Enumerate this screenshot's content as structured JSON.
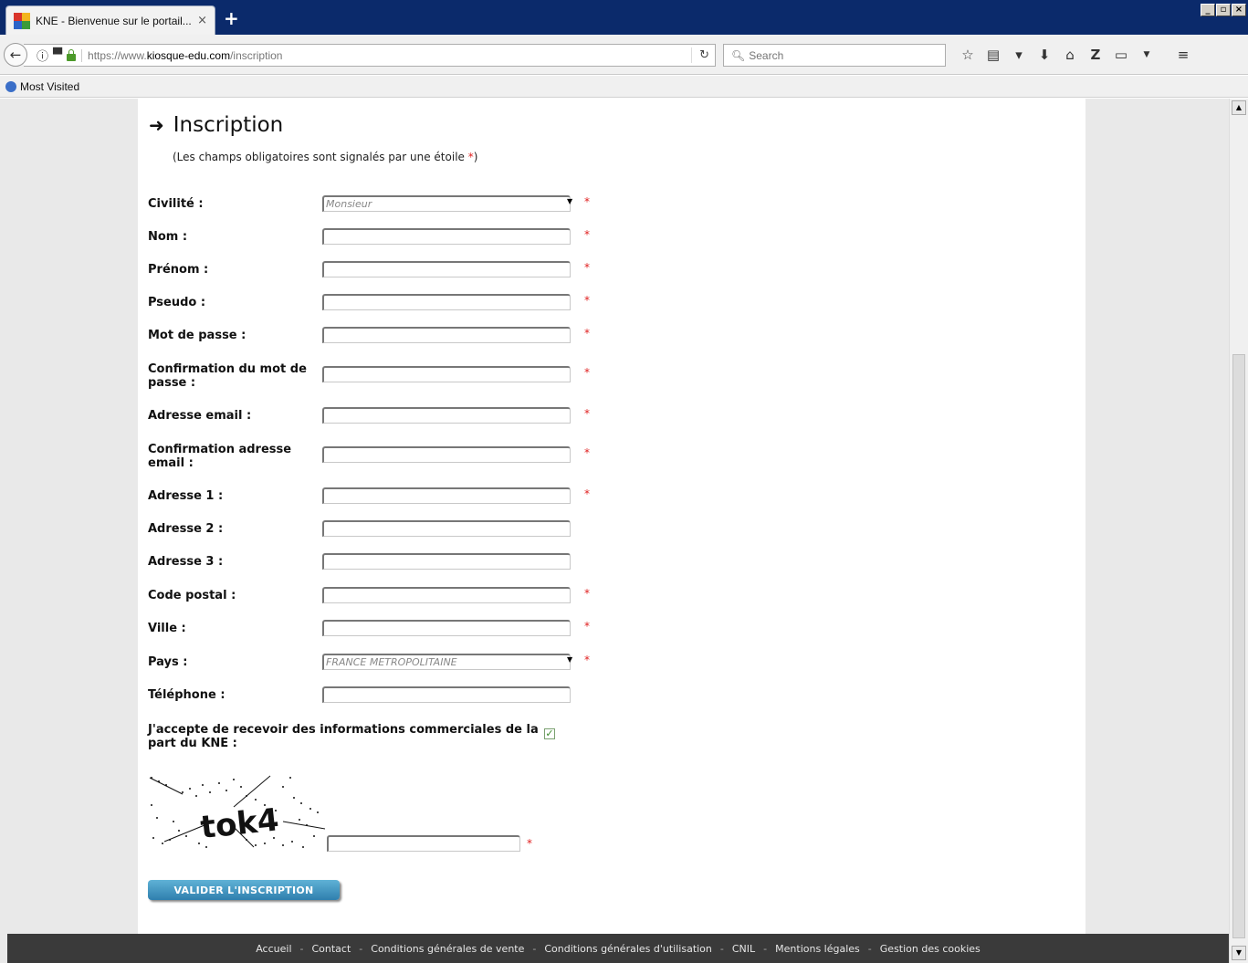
{
  "browser": {
    "tab_title": "KNE - Bienvenue sur le portail...",
    "tab_close": "×",
    "new_tab": "+",
    "url_prefix": "https://www.",
    "url_domain": "kiosque-edu.com",
    "url_path": "/inscription",
    "search_placeholder": "Search",
    "bookmark_label": "Most Visited",
    "window_buttons": [
      "_",
      "▫",
      "×"
    ],
    "toolbar_icons": [
      "star-icon",
      "reader-icon",
      "pocket-icon",
      "download-icon",
      "home-icon",
      "zotero-icon",
      "page-icon",
      "dropdown-icon",
      "menu-icon"
    ]
  },
  "page": {
    "title": "Inscription",
    "required_note_prefix": "(Les champs obligatoires sont signalés par une étoile ",
    "required_note_star": "*",
    "required_note_suffix": ")"
  },
  "form": {
    "required_marker": "*",
    "fields": [
      {
        "label": "Civilité :",
        "type": "select",
        "value": "Monsieur",
        "required": true
      },
      {
        "label": "Nom :",
        "type": "text",
        "value": "",
        "required": true
      },
      {
        "label": "Prénom :",
        "type": "text",
        "value": "",
        "required": true
      },
      {
        "label": "Pseudo :",
        "type": "text",
        "value": "",
        "required": true
      },
      {
        "label": "Mot de passe :",
        "type": "password",
        "value": "",
        "required": true
      },
      {
        "label": "Confirmation du mot de passe :",
        "type": "password",
        "value": "",
        "required": true
      },
      {
        "label": "Adresse email :",
        "type": "text",
        "value": "",
        "required": true
      },
      {
        "label": "Confirmation adresse email :",
        "type": "text",
        "value": "",
        "required": true
      },
      {
        "label": "Adresse 1 :",
        "type": "text",
        "value": "",
        "required": true
      },
      {
        "label": "Adresse 2 :",
        "type": "text",
        "value": "",
        "required": false
      },
      {
        "label": "Adresse 3 :",
        "type": "text",
        "value": "",
        "required": false
      },
      {
        "label": "Code postal :",
        "type": "text",
        "value": "",
        "required": true
      },
      {
        "label": "Ville :",
        "type": "text",
        "value": "",
        "required": true
      },
      {
        "label": "Pays :",
        "type": "select",
        "value": "FRANCE METROPOLITAINE",
        "required": true
      },
      {
        "label": "Téléphone :",
        "type": "text",
        "value": "",
        "required": false
      }
    ],
    "consent_label": "J'accepte de recevoir des informations commerciales de la part du KNE :",
    "consent_checked": true,
    "captcha_text": "tok4",
    "submit_label": "VALIDER L'INSCRIPTION"
  },
  "footer": {
    "links": [
      "Accueil",
      "Contact",
      "Conditions générales de vente",
      "Conditions générales d'utilisation",
      "CNIL",
      "Mentions légales",
      "Gestion des cookies"
    ],
    "separator": "-"
  },
  "colors": {
    "titlebar": "#0b2a6b",
    "required_star": "#e02020",
    "submit_button": "#2f7fae",
    "footer_bg": "#3a3a3a"
  }
}
